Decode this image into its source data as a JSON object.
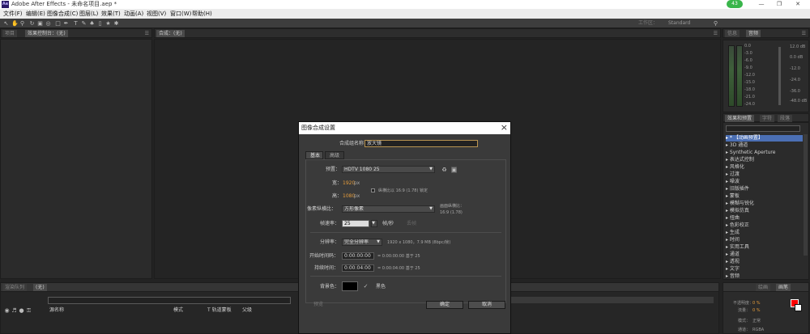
{
  "window": {
    "title": "Adobe After Effects - 未命名项目.aep *",
    "logo": "Ae",
    "badge": "43",
    "controls": [
      "minimize-icon",
      "restore-icon",
      "close-icon"
    ]
  },
  "menu": [
    "文件(F)",
    "编辑(E)",
    "图像合成(C)",
    "图层(L)",
    "效果(T)",
    "动画(A)",
    "视图(V)",
    "窗口(W)",
    "帮助(H)"
  ],
  "toolbar": {
    "workspace_label": "工作区：",
    "workspace_value": "Standard"
  },
  "project_panel": {
    "tab1": "项目",
    "tab2": "效果控制台：(无)"
  },
  "comp_panel": {
    "tab": "合成：(无)"
  },
  "audio_panel": {
    "tab1": "信息",
    "tab2": "音频",
    "left_scale": [
      "0.0",
      "-3.0",
      "-6.0",
      "-9.0",
      "-12.0",
      "-15.0",
      "-18.0",
      "-21.0",
      "-24.0"
    ],
    "right_scale": [
      "12.0 dB",
      "0.0 dB",
      "-12.0",
      "-24.0",
      "-36.0",
      "-48.0 dB"
    ]
  },
  "effects_panel": {
    "tab1": "效果和预置",
    "tab2": "字符",
    "tab3": "段落",
    "items": [
      "* 【动画预置】",
      "3D 通道",
      "Synthetic Aperture",
      "表达式控制",
      "风格化",
      "过渡",
      "噪波",
      "旧版插件",
      "蒙板",
      "模糊与锐化",
      "模拟仿真",
      "扭曲",
      "色彩校正",
      "生成",
      "时间",
      "实用工具",
      "通道",
      "透视",
      "文字",
      "音频"
    ]
  },
  "timeline_panel": {
    "tab1": "渲染队列",
    "tab2": "(无)",
    "col_source": "源名称",
    "col_mode": "模式",
    "col_trkmat": "T 轨道蒙板",
    "col_parent": "父级"
  },
  "paint_panel": {
    "tab1": "绘画",
    "tab2": "画笔",
    "opacity_label": "不透明度：",
    "opacity_value": "0 %",
    "flow_label": "流量：",
    "flow_value": "0 %",
    "mode_label": "模式：",
    "mode_value": "正常",
    "channel_label": "通道：",
    "channel_value": "RGBA"
  },
  "dialog": {
    "title": "图像合成设置",
    "name_label": "合成组名称：",
    "name_value": "放大镜",
    "tab_basic": "基本",
    "tab_advanced": "高级",
    "preset_label": "预置：",
    "preset_value": "HDTV 1080 25",
    "width_label": "宽：",
    "width_value": "1920",
    "px": "px",
    "height_label": "高：",
    "height_value": "1080",
    "lock_label": "纵横比以 16:9 (1.78) 锁定",
    "par_label": "像素纵横比：",
    "par_value": "方形像素",
    "frame_aspect_label": "画面纵横比：",
    "frame_aspect_value": "16:9 (1.78)",
    "fps_label": "帧速率：",
    "fps_value": "25",
    "fps_unit": "帧/秒",
    "drop_frame": "丢帧",
    "res_label": "分辨率：",
    "res_value": "完全分辨率",
    "res_info": "1920 x 1080，7.9 MB (8bpc/帧)",
    "start_label": "开始时间码：",
    "start_value": "0:00:00:00",
    "start_info": "= 0:00:00:00  基于 25",
    "dur_label": "持续时间：",
    "dur_value": "0:00:04:00",
    "dur_info": "= 0:00:04:00  基于 25",
    "bg_label": "背景色：",
    "bg_name": "黑色",
    "bg_color": "#000000",
    "preview_label": "预览",
    "ok": "确定",
    "cancel": "取消"
  },
  "colors": {
    "accent_orange": "#e69d3b",
    "selection_blue": "#4b6fb4",
    "foreground_swatch": "#ff0000"
  }
}
